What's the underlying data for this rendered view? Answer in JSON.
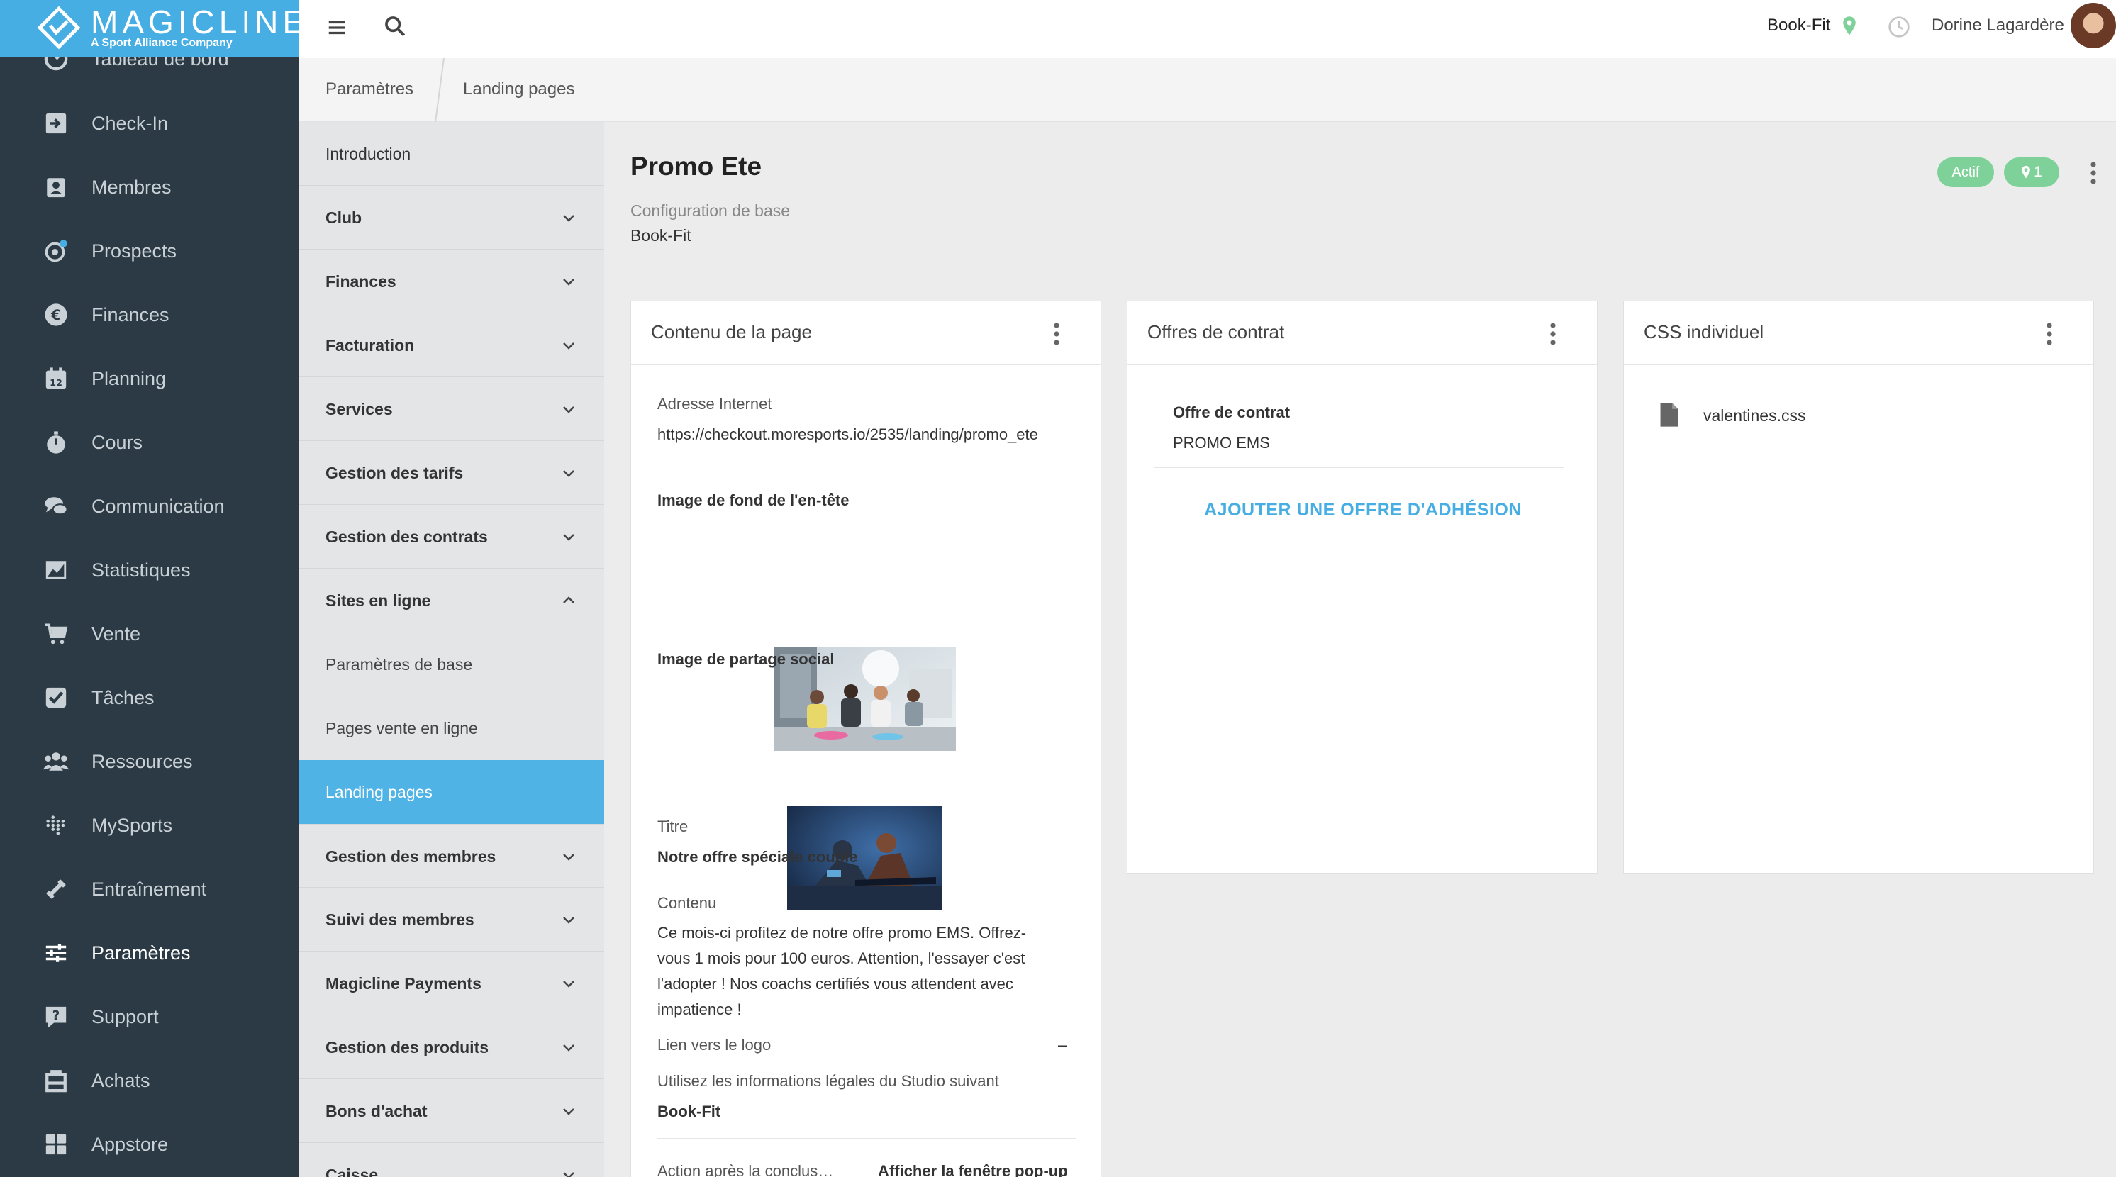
{
  "app": {
    "logo_text": "MAGICLINE",
    "logo_sub": "A Sport Alliance Company"
  },
  "topbar": {
    "club": "Book-Fit",
    "user": "Dorine Lagardère"
  },
  "leftnav": {
    "items": [
      {
        "label": "Tableau de bord",
        "icon": "dashboard-icon"
      },
      {
        "label": "Check-In",
        "icon": "check-in-icon"
      },
      {
        "label": "Membres",
        "icon": "members-icon"
      },
      {
        "label": "Prospects",
        "icon": "prospects-icon"
      },
      {
        "label": "Finances",
        "icon": "euro-icon"
      },
      {
        "label": "Planning",
        "icon": "calendar-icon"
      },
      {
        "label": "Cours",
        "icon": "stopwatch-icon"
      },
      {
        "label": "Communication",
        "icon": "chat-icon"
      },
      {
        "label": "Statistiques",
        "icon": "chart-icon"
      },
      {
        "label": "Vente",
        "icon": "cart-icon"
      },
      {
        "label": "Tâches",
        "icon": "checkbox-icon"
      },
      {
        "label": "Ressources",
        "icon": "people-icon"
      },
      {
        "label": "MySports",
        "icon": "dots-grid-icon"
      },
      {
        "label": "Entraînement",
        "icon": "dumbbell-icon"
      },
      {
        "label": "Paramètres",
        "icon": "sliders-icon"
      },
      {
        "label": "Support",
        "icon": "help-icon"
      },
      {
        "label": "Achats",
        "icon": "shop-icon"
      },
      {
        "label": "Appstore",
        "icon": "apps-icon"
      }
    ],
    "active": "Paramètres"
  },
  "breadcrumb": {
    "items": [
      "Paramètres",
      "Landing pages"
    ]
  },
  "subnav": {
    "items": [
      {
        "label": "Introduction"
      },
      {
        "label": "Club"
      },
      {
        "label": "Finances"
      },
      {
        "label": "Facturation"
      },
      {
        "label": "Services"
      },
      {
        "label": "Gestion des tarifs"
      },
      {
        "label": "Gestion des contrats"
      },
      {
        "label": "Sites en ligne"
      },
      {
        "label": "Paramètres de base"
      },
      {
        "label": "Pages vente en ligne"
      },
      {
        "label": "Landing pages"
      },
      {
        "label": "Gestion des membres"
      },
      {
        "label": "Suivi des membres"
      },
      {
        "label": "Magicline Payments"
      },
      {
        "label": "Gestion des produits"
      },
      {
        "label": "Bons d'achat"
      },
      {
        "label": "Caisse"
      }
    ]
  },
  "page": {
    "title": "Promo Ete",
    "config_label": "Configuration de base",
    "config_value": "Book-Fit",
    "status_badge": "Actif",
    "location_count": "1"
  },
  "content_card": {
    "title": "Contenu de la page",
    "address_label": "Adresse Internet",
    "address_value": "https://checkout.moresports.io/2535/landing/promo_ete",
    "header_image_label": "Image de fond de l'en-tête",
    "social_image_label": "Image de partage social",
    "titre_label": "Titre",
    "titre_value": "Notre offre spéciale couple",
    "contenu_label": "Contenu",
    "contenu_lines": [
      "Ce mois-ci profitez de notre offre promo EMS. Offrez-",
      "vous 1 mois pour 100 euros. Attention, l'essayer c'est",
      "l'adopter ! Nos coachs certifiés vous attendent avec",
      "impatience !"
    ],
    "logo_link_label": "Lien vers le logo",
    "logo_link_value": "–",
    "legal_label": "Utilisez les informations légales du Studio suivant",
    "legal_value": "Book-Fit",
    "action_label": "Action après la conclus…",
    "action_value": "Afficher la fenêtre pop-up"
  },
  "offers_card": {
    "title": "Offres de contrat",
    "offer_label": "Offre de contrat",
    "offer_value": "PROMO EMS",
    "add_button": "AJOUTER UNE OFFRE D'ADHÉSION"
  },
  "css_card": {
    "title": "CSS individuel",
    "file_name": "valentines.css"
  },
  "colors": {
    "sidebar": "#2b3a44",
    "brand": "#46aee3",
    "badge_green": "#7fd19a",
    "subnav_selected": "#4fb3e6"
  }
}
